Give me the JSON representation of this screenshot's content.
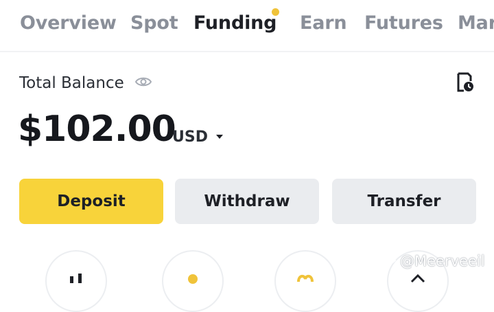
{
  "tabs": [
    {
      "label": "Overview",
      "active": false
    },
    {
      "label": "Spot",
      "active": false
    },
    {
      "label": "Funding",
      "active": true
    },
    {
      "label": "Earn",
      "active": false
    },
    {
      "label": "Futures",
      "active": false
    },
    {
      "label": "Mar",
      "active": false
    }
  ],
  "balance": {
    "label": "Total Balance",
    "amount": "$102.00",
    "currency": "USD"
  },
  "actions": {
    "deposit": "Deposit",
    "withdraw": "Withdraw",
    "transfer": "Transfer"
  },
  "watermark": "@Meerveeil",
  "colors": {
    "accent": "#f8d33a",
    "notification_dot": "#f0c33a",
    "inactive_tab": "#8a8f99",
    "button_secondary": "#eaecef"
  },
  "icons": [
    "eye-icon",
    "history-icon",
    "caret-down-icon"
  ]
}
